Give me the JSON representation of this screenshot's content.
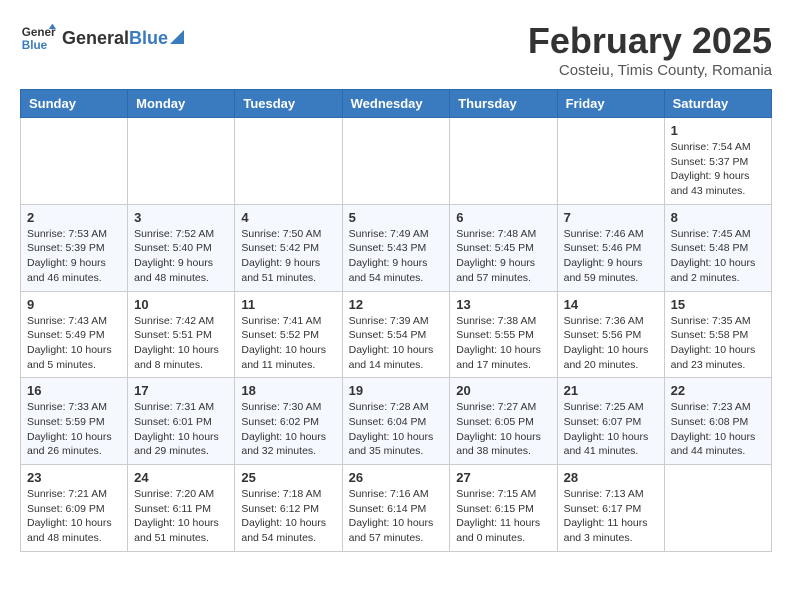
{
  "logo": {
    "general": "General",
    "blue": "Blue"
  },
  "header": {
    "title": "February 2025",
    "subtitle": "Costeiu, Timis County, Romania"
  },
  "weekdays": [
    "Sunday",
    "Monday",
    "Tuesday",
    "Wednesday",
    "Thursday",
    "Friday",
    "Saturday"
  ],
  "weeks": [
    [
      {
        "day": "",
        "info": ""
      },
      {
        "day": "",
        "info": ""
      },
      {
        "day": "",
        "info": ""
      },
      {
        "day": "",
        "info": ""
      },
      {
        "day": "",
        "info": ""
      },
      {
        "day": "",
        "info": ""
      },
      {
        "day": "1",
        "info": "Sunrise: 7:54 AM\nSunset: 5:37 PM\nDaylight: 9 hours\nand 43 minutes."
      }
    ],
    [
      {
        "day": "2",
        "info": "Sunrise: 7:53 AM\nSunset: 5:39 PM\nDaylight: 9 hours\nand 46 minutes."
      },
      {
        "day": "3",
        "info": "Sunrise: 7:52 AM\nSunset: 5:40 PM\nDaylight: 9 hours\nand 48 minutes."
      },
      {
        "day": "4",
        "info": "Sunrise: 7:50 AM\nSunset: 5:42 PM\nDaylight: 9 hours\nand 51 minutes."
      },
      {
        "day": "5",
        "info": "Sunrise: 7:49 AM\nSunset: 5:43 PM\nDaylight: 9 hours\nand 54 minutes."
      },
      {
        "day": "6",
        "info": "Sunrise: 7:48 AM\nSunset: 5:45 PM\nDaylight: 9 hours\nand 57 minutes."
      },
      {
        "day": "7",
        "info": "Sunrise: 7:46 AM\nSunset: 5:46 PM\nDaylight: 9 hours\nand 59 minutes."
      },
      {
        "day": "8",
        "info": "Sunrise: 7:45 AM\nSunset: 5:48 PM\nDaylight: 10 hours\nand 2 minutes."
      }
    ],
    [
      {
        "day": "9",
        "info": "Sunrise: 7:43 AM\nSunset: 5:49 PM\nDaylight: 10 hours\nand 5 minutes."
      },
      {
        "day": "10",
        "info": "Sunrise: 7:42 AM\nSunset: 5:51 PM\nDaylight: 10 hours\nand 8 minutes."
      },
      {
        "day": "11",
        "info": "Sunrise: 7:41 AM\nSunset: 5:52 PM\nDaylight: 10 hours\nand 11 minutes."
      },
      {
        "day": "12",
        "info": "Sunrise: 7:39 AM\nSunset: 5:54 PM\nDaylight: 10 hours\nand 14 minutes."
      },
      {
        "day": "13",
        "info": "Sunrise: 7:38 AM\nSunset: 5:55 PM\nDaylight: 10 hours\nand 17 minutes."
      },
      {
        "day": "14",
        "info": "Sunrise: 7:36 AM\nSunset: 5:56 PM\nDaylight: 10 hours\nand 20 minutes."
      },
      {
        "day": "15",
        "info": "Sunrise: 7:35 AM\nSunset: 5:58 PM\nDaylight: 10 hours\nand 23 minutes."
      }
    ],
    [
      {
        "day": "16",
        "info": "Sunrise: 7:33 AM\nSunset: 5:59 PM\nDaylight: 10 hours\nand 26 minutes."
      },
      {
        "day": "17",
        "info": "Sunrise: 7:31 AM\nSunset: 6:01 PM\nDaylight: 10 hours\nand 29 minutes."
      },
      {
        "day": "18",
        "info": "Sunrise: 7:30 AM\nSunset: 6:02 PM\nDaylight: 10 hours\nand 32 minutes."
      },
      {
        "day": "19",
        "info": "Sunrise: 7:28 AM\nSunset: 6:04 PM\nDaylight: 10 hours\nand 35 minutes."
      },
      {
        "day": "20",
        "info": "Sunrise: 7:27 AM\nSunset: 6:05 PM\nDaylight: 10 hours\nand 38 minutes."
      },
      {
        "day": "21",
        "info": "Sunrise: 7:25 AM\nSunset: 6:07 PM\nDaylight: 10 hours\nand 41 minutes."
      },
      {
        "day": "22",
        "info": "Sunrise: 7:23 AM\nSunset: 6:08 PM\nDaylight: 10 hours\nand 44 minutes."
      }
    ],
    [
      {
        "day": "23",
        "info": "Sunrise: 7:21 AM\nSunset: 6:09 PM\nDaylight: 10 hours\nand 48 minutes."
      },
      {
        "day": "24",
        "info": "Sunrise: 7:20 AM\nSunset: 6:11 PM\nDaylight: 10 hours\nand 51 minutes."
      },
      {
        "day": "25",
        "info": "Sunrise: 7:18 AM\nSunset: 6:12 PM\nDaylight: 10 hours\nand 54 minutes."
      },
      {
        "day": "26",
        "info": "Sunrise: 7:16 AM\nSunset: 6:14 PM\nDaylight: 10 hours\nand 57 minutes."
      },
      {
        "day": "27",
        "info": "Sunrise: 7:15 AM\nSunset: 6:15 PM\nDaylight: 11 hours\nand 0 minutes."
      },
      {
        "day": "28",
        "info": "Sunrise: 7:13 AM\nSunset: 6:17 PM\nDaylight: 11 hours\nand 3 minutes."
      },
      {
        "day": "",
        "info": ""
      }
    ]
  ]
}
